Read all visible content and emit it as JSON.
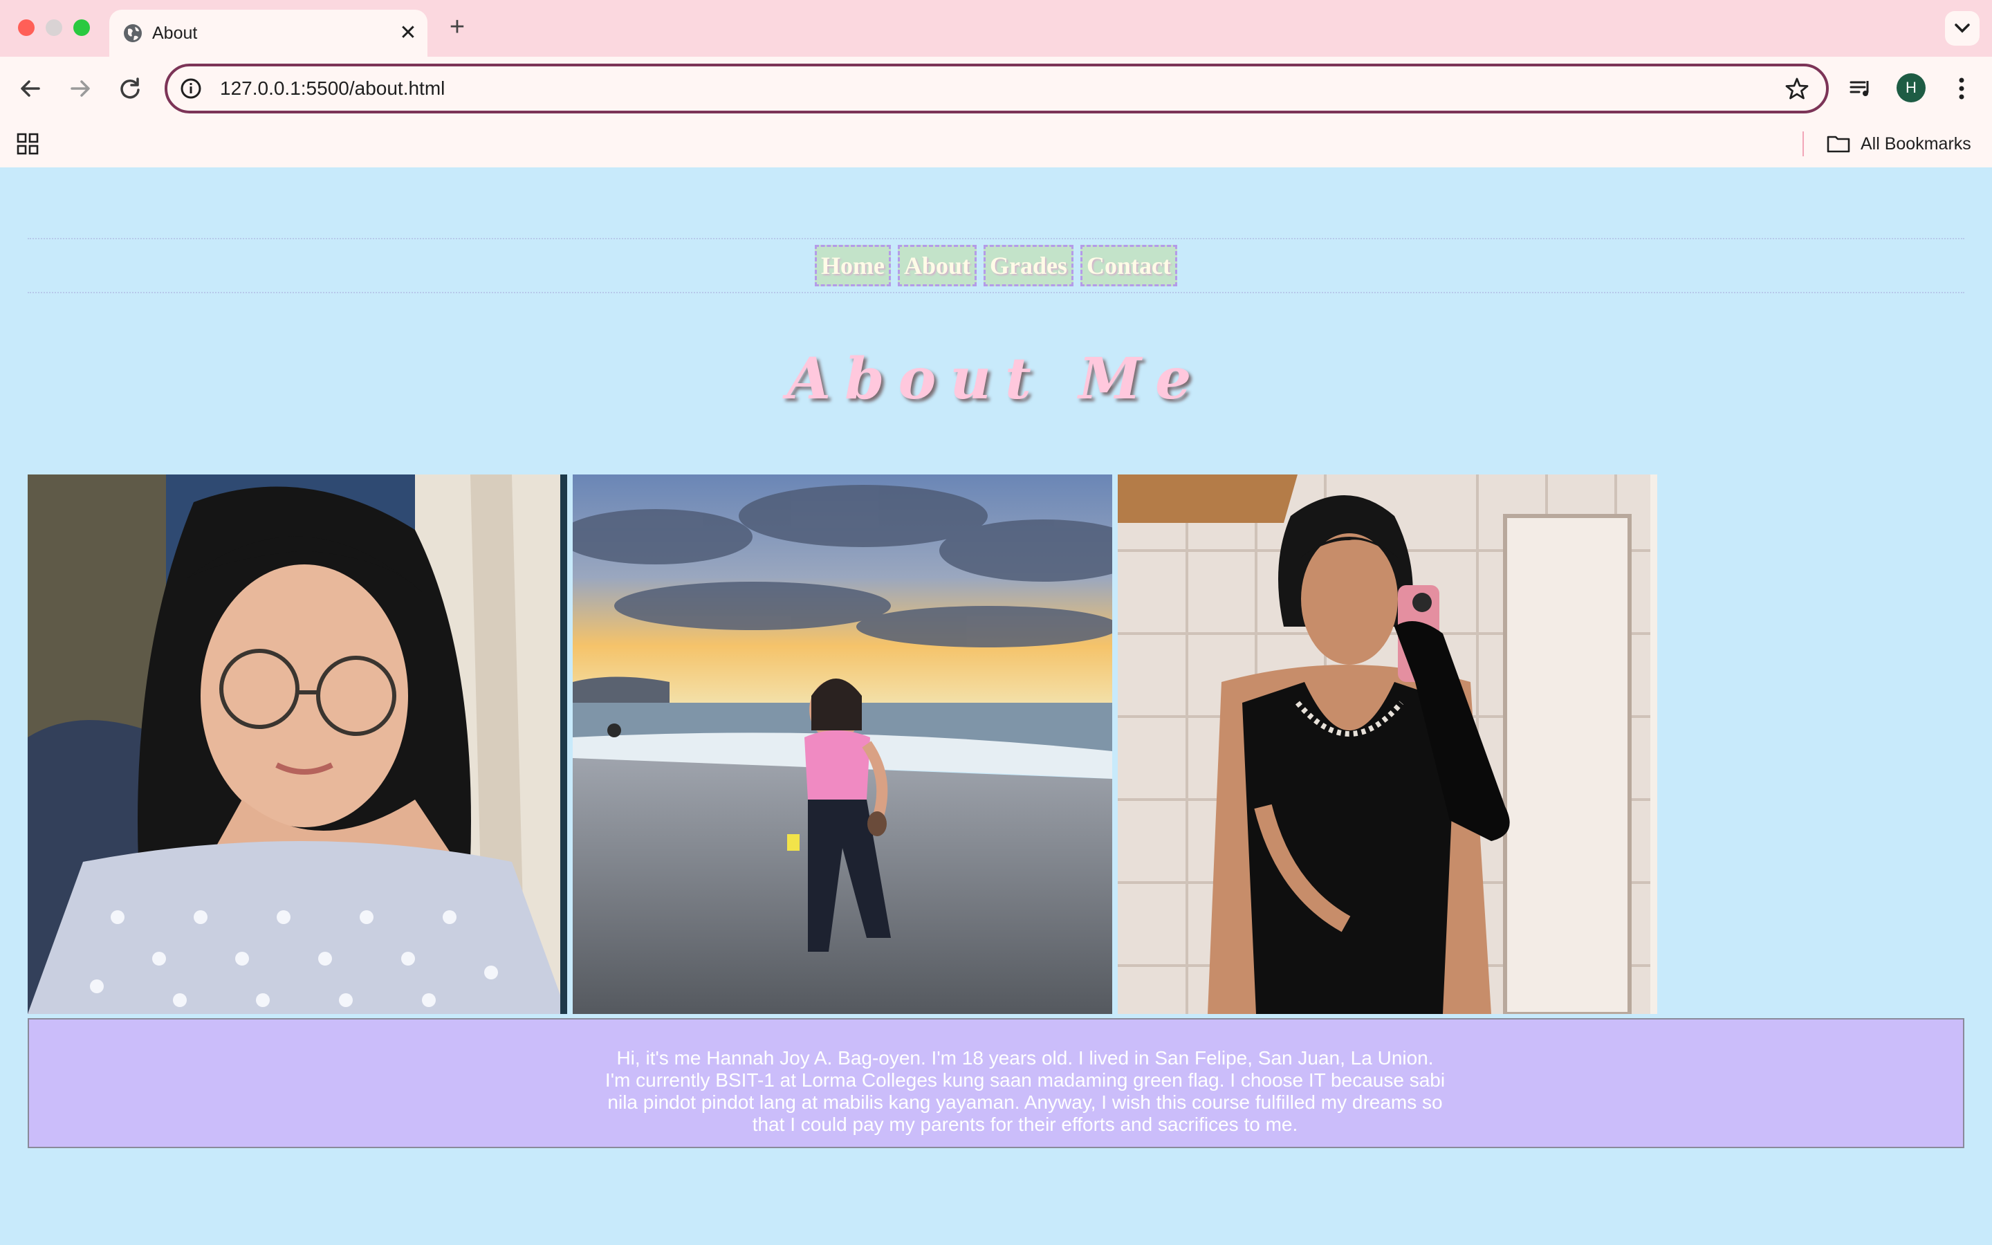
{
  "browser": {
    "tab_title": "About",
    "url": "127.0.0.1:5500/about.html",
    "profile_initial": "H",
    "bookmarks_label": "All Bookmarks"
  },
  "nav": {
    "items": [
      {
        "label": "Home"
      },
      {
        "label": "About"
      },
      {
        "label": "Grades"
      },
      {
        "label": "Contact"
      }
    ]
  },
  "page": {
    "heading": "About Me",
    "about_lines": [
      "Hi, it's me Hannah Joy A. Bag-oyen. I'm 18 years old. I lived in San Felipe, San Juan, La Union.",
      "I'm currently BSIT-1 at Lorma Colleges kung saan madaming green flag. I choose IT because sabi",
      "nila pindot pindot lang at mabilis kang yayaman. Anyway, I wish this course fulfilled my dreams so",
      "that I could pay my parents for their efforts and sacrifices to me."
    ]
  },
  "colors": {
    "page_bg": "#c8eafb",
    "heading": "#ffc8dd",
    "about_box": "#cbbdfa",
    "nav_bg": "#c3e3c9",
    "tabbar": "#fbd8df"
  }
}
